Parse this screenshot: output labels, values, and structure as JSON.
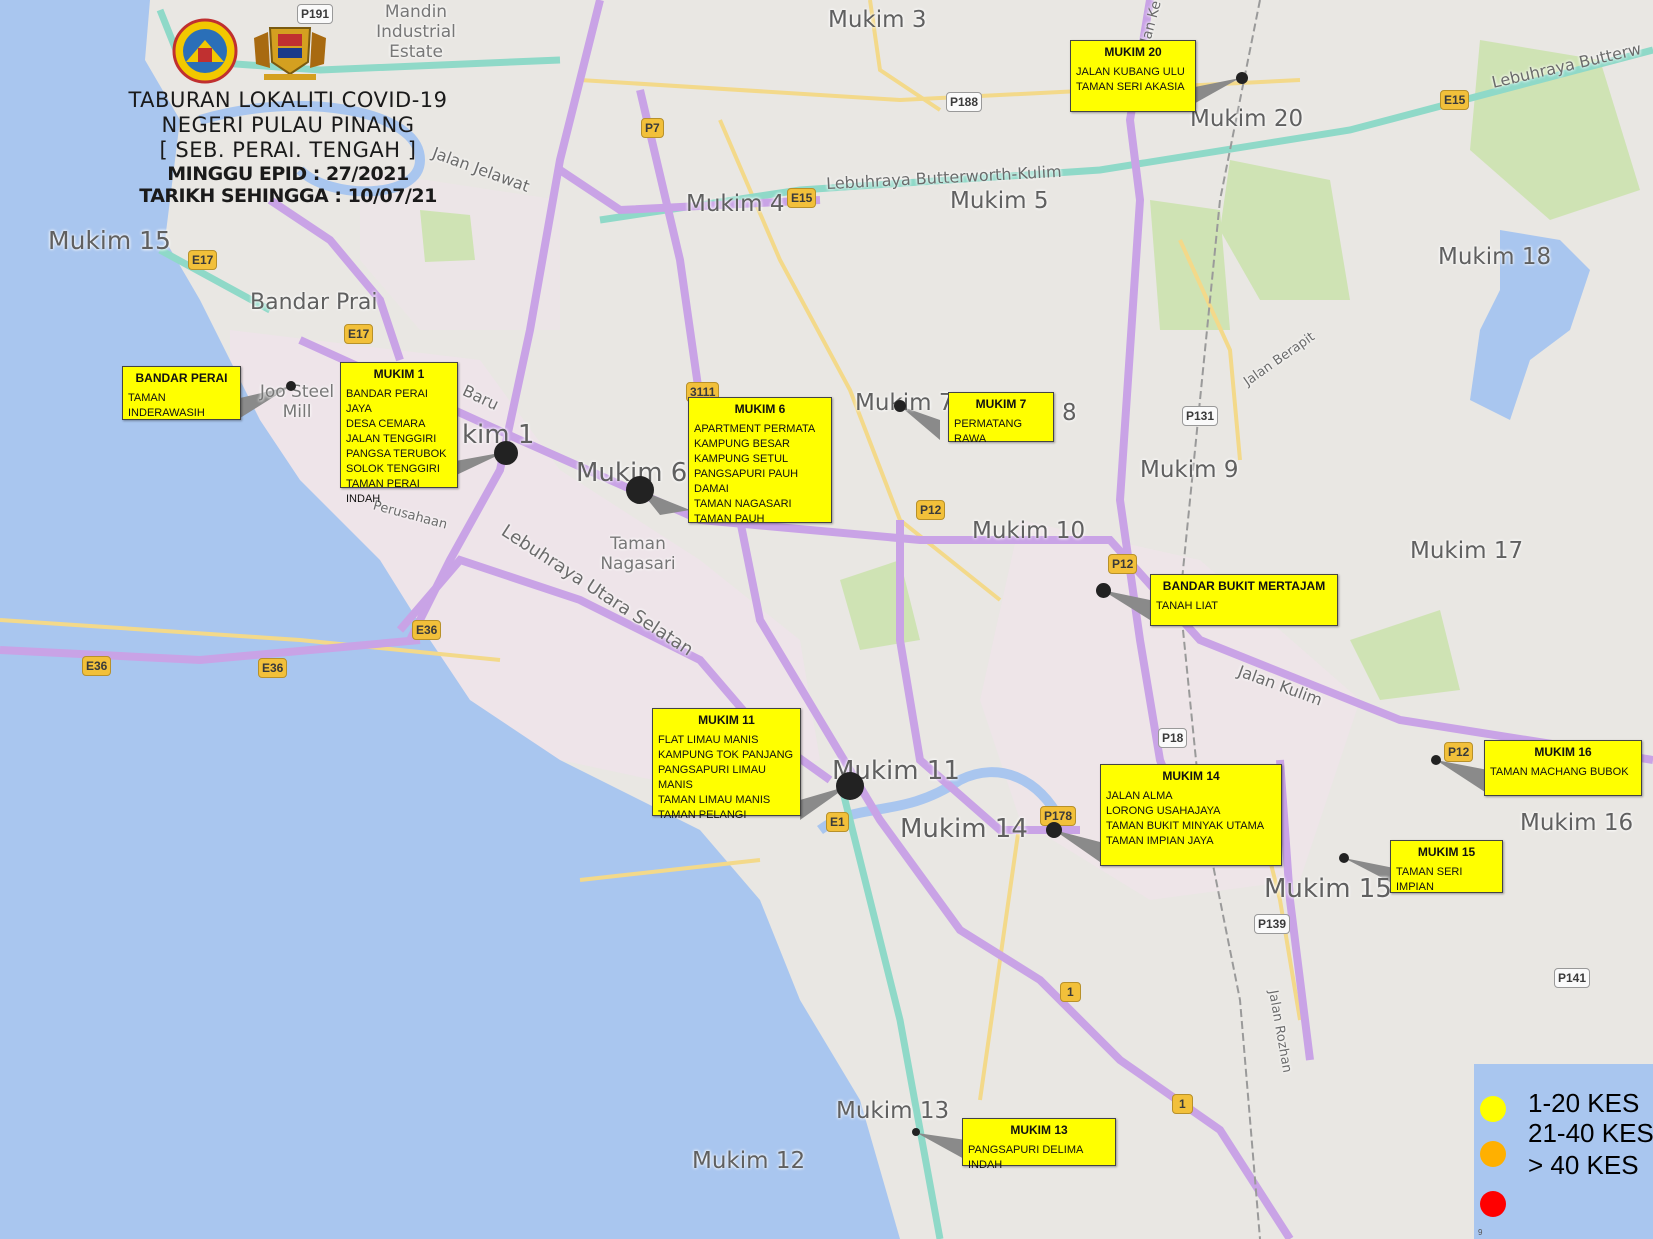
{
  "header": {
    "line1": "TABURAN LOKALITI COVID-19",
    "line2": "NEGERI PULAU PINANG",
    "line3": "[ SEB. PERAI. TENGAH ]",
    "line4": "MINGGU EPID : 27/2021",
    "line5": "TARIKH SEHINGGA : 10/07/21"
  },
  "colors": {
    "sea": "#a9c6ef",
    "land": "#e9e7e3",
    "urban": "#efe4ea",
    "park": "#cfe3b4",
    "highway": "#c9a3e6",
    "expressway": "#8fd9c8",
    "minor_road": "#f3d98a",
    "callout": "#ffff00",
    "level_low": "#ffff00",
    "level_mid": "#ffb000",
    "level_high": "#ff0000"
  },
  "legend": {
    "items": [
      {
        "label": "1-20 KES",
        "color": "#ffff00"
      },
      {
        "label": "21-40 KES",
        "color": "#ffb000"
      },
      {
        "label": "> 40 KES",
        "color": "#ff0000"
      }
    ],
    "footnote": "9"
  },
  "area_labels": {
    "mukim3": "Mukim 3",
    "mukim4": "Mukim 4",
    "mukim5": "Mukim 5",
    "mukim6": "Mukim 6",
    "mukim7": "Mukim 7",
    "mukim8": "8",
    "mukim9": "Mukim 9",
    "mukim10": "Mukim 10",
    "mukim11": "Mukim 11",
    "mukim12": "Mukim 12",
    "mukim13": "Mukim 13",
    "mukim14": "Mukim 14",
    "mukim15a": "Mukim 15",
    "mukim15b": "Mukim 15",
    "mukim16": "Mukim 16",
    "mukim17": "Mukim 17",
    "mukim18": "Mukim 18",
    "mukim20": "Mukim 20",
    "mukim1": "kim 1",
    "bandar_prai": "Bandar Prai",
    "mandin": "Mandin Industrial Estate",
    "taman_nagasari": "Taman Nagasari",
    "mill": "Joo Steel Mill"
  },
  "road_labels": {
    "lebuhraya_bk": "Lebuhraya Butterworth-Kulim",
    "lebuhraya_butterw": "Lebuhraya Butterw",
    "lebuhraya_utara": "Lebuhraya Utara Selatan",
    "jalan_jelawat": "Jalan Jelawat",
    "jalan_kulim": "Jalan Kulim",
    "jalan_berapit": "Jalan Berapit",
    "jalan_rozhan": "Jalan Rozhan",
    "baru": "Baru",
    "perusahaan": "Perusahaan",
    "kebun": "Jalan Ke"
  },
  "shields": {
    "p191": "P191",
    "p188": "P188",
    "p7": "P7",
    "e15a": "E15",
    "e15b": "E15",
    "e17a": "E17",
    "e17b": "E17",
    "n3111": "3111",
    "p12a": "P12",
    "p12b": "P12",
    "p12c": "P12",
    "p131": "P131",
    "e36a": "E36",
    "e36b": "E36",
    "e36c": "E36",
    "p18": "P18",
    "e1": "E1",
    "p178": "P178",
    "p139": "P139",
    "p141": "P141",
    "r1a": "1",
    "r1b": "1"
  },
  "localities": [
    {
      "id": "bandar-perai",
      "title": "BANDAR PERAI",
      "places": [
        "TAMAN INDERAWASIH"
      ],
      "level": "1-20 KES"
    },
    {
      "id": "mukim-1",
      "title": "MUKIM 1",
      "places": [
        "BANDAR PERAI JAYA",
        "DESA CEMARA",
        "JALAN TENGGIRI",
        "PANGSA TERUBOK",
        "SOLOK TENGGIRI",
        "TAMAN PERAI INDAH"
      ],
      "level": "1-20 KES"
    },
    {
      "id": "mukim-6",
      "title": "MUKIM 6",
      "places": [
        "APARTMENT PERMATA",
        "KAMPUNG BESAR",
        "KAMPUNG SETUL",
        "PANGSAPURI PAUH DAMAI",
        "TAMAN NAGASARI",
        "TAMAN PAUH"
      ],
      "level": "1-20 KES"
    },
    {
      "id": "mukim-7",
      "title": "MUKIM 7",
      "places": [
        "PERMATANG RAWA"
      ],
      "level": "1-20 KES"
    },
    {
      "id": "mukim-20",
      "title": "MUKIM 20",
      "places": [
        "JALAN KUBANG ULU",
        "TAMAN SERI AKASIA"
      ],
      "level": "1-20 KES"
    },
    {
      "id": "bandar-bukit-mertajam",
      "title": "BANDAR BUKIT MERTAJAM",
      "places": [
        "TANAH LIAT"
      ],
      "level": "1-20 KES"
    },
    {
      "id": "mukim-11",
      "title": "MUKIM 11",
      "places": [
        "FLAT LIMAU MANIS",
        "KAMPUNG TOK PANJANG",
        "PANGSAPURI LIMAU MANIS",
        "TAMAN LIMAU MANIS",
        "TAMAN PELANGI"
      ],
      "level": "1-20 KES"
    },
    {
      "id": "mukim-14",
      "title": "MUKIM 14",
      "places": [
        "JALAN ALMA",
        "LORONG USAHAJAYA",
        "TAMAN BUKIT MINYAK UTAMA",
        "TAMAN IMPIAN JAYA"
      ],
      "level": "1-20 KES"
    },
    {
      "id": "mukim-16",
      "title": "MUKIM 16",
      "places": [
        "TAMAN MACHANG BUBOK"
      ],
      "level": "1-20 KES"
    },
    {
      "id": "mukim-15",
      "title": "MUKIM 15",
      "places": [
        "TAMAN SERI IMPIAN"
      ],
      "level": "1-20 KES"
    },
    {
      "id": "mukim-13",
      "title": "MUKIM 13",
      "places": [
        "PANGSAPURI DELIMA INDAH"
      ],
      "level": "1-20 KES"
    }
  ]
}
